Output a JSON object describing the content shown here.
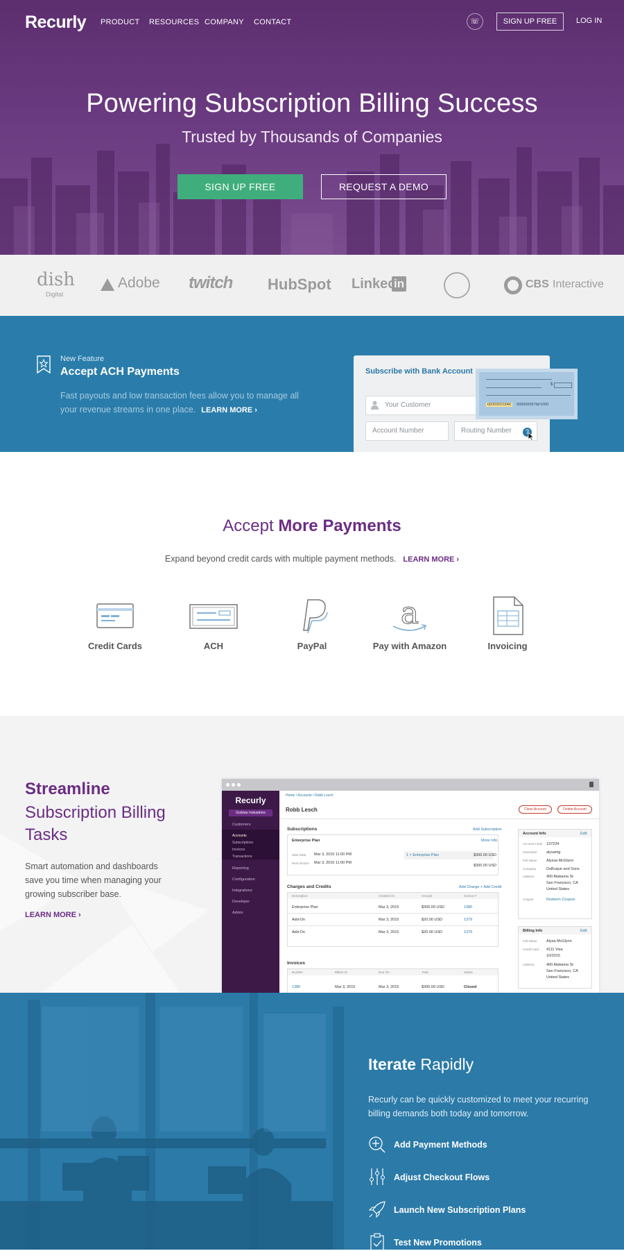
{
  "nav": {
    "logo": "Recurly",
    "product": "PRODUCT",
    "resources": "RESOURCES",
    "company": "COMPANY",
    "contact": "CONTACT",
    "signup": "SIGN UP FREE",
    "login": "LOG IN"
  },
  "hero": {
    "title": "Powering Subscription Billing Success",
    "subtitle": "Trusted by Thousands of Companies",
    "signup": "SIGN UP FREE",
    "demo": "REQUEST A DEMO"
  },
  "logos": [
    "dish",
    "Digital",
    "Adobe",
    "twitch",
    "HubSpot",
    "Linked",
    "in",
    "CBS",
    "Interactive"
  ],
  "ach": {
    "tag": "New Feature",
    "title": "Accept ACH Payments",
    "desc": "Fast payouts and low transaction fees allow you to manage all your revenue streams in one place.",
    "learn": "LEARN MORE ›",
    "form_title": "Subscribe with Bank Account",
    "customer": "Your Customer",
    "account": "Account Number",
    "routing": "Routing Number",
    "q": "?",
    "check_routing": "⑆000000184⑆",
    "check_account": "0000000579⑈",
    "check_no": "1000",
    "check_dollar": "$"
  },
  "payments": {
    "title_a": "Accept ",
    "title_b": "More Payments",
    "sub": "Expand beyond credit cards with multiple payment methods.",
    "learn": "LEARN MORE ›",
    "methods": [
      "Credit Cards",
      "ACH",
      "PayPal",
      "Pay with Amazon",
      "Invoicing"
    ]
  },
  "stream": {
    "title1": "Streamline",
    "title2": "Subscription Billing Tasks",
    "desc": "Smart automation and dashboards save you time when managing your growing subscriber base.",
    "learn": "LEARN MORE ›"
  },
  "app": {
    "logo": "Recurly",
    "company": "Goblas Industries",
    "nav": [
      "Customers",
      "Reporting",
      "Configuration",
      "Integrations",
      "Developer",
      "Admin"
    ],
    "subnav": [
      "Accounts",
      "Subscriptions",
      "Invoices",
      "Transactions"
    ],
    "crumbs": "Home  /  Accounts  /  Robb Lesch",
    "name": "Robb Lesch",
    "close": "Close Account",
    "delete": "Delete Account",
    "subs_title": "Subscriptions",
    "add_sub": "Add Subscription",
    "plan": "Enterprise Plan",
    "more": "More Info",
    "start_lbl": "Start Date",
    "start": "Mar 3, 2015 11:00 PM",
    "next_lbl": "Next Invoice",
    "next": "Mar 3, 2016 11:00 PM",
    "plan_line": "1 × Enterprise Plan",
    "plan_amt": "$300.00 USD",
    "plan_total": "$300.00 USD",
    "charges_title": "Charges and Credits",
    "add_charge": "Add Charge  +  Add Credit",
    "charges_head": [
      "Description",
      "Created On",
      "Amount",
      "Invoice #"
    ],
    "charges": [
      [
        "Enterprise Plan",
        "Mar 3, 2015",
        "$300.00 USD",
        "1380"
      ],
      [
        "Add-On",
        "Mar 3, 2015",
        "$20.00 USD",
        "1379"
      ],
      [
        "Add-On",
        "Mar 3, 2015",
        "$20.00 USD",
        "1379"
      ]
    ],
    "inv_title": "Invoices",
    "inv_head": [
      "Number",
      "Billed On",
      "Due On",
      "Total",
      "Status"
    ],
    "inv_row": [
      "1380",
      "Mar 3, 2015",
      "Mar 3, 2015",
      "$300.00 USD",
      "Closed"
    ],
    "acct_title": "Account Info",
    "edit": "Edit",
    "acct": [
      [
        "Account Code",
        "137234"
      ],
      [
        "Username",
        "alysamg"
      ],
      [
        "Full Name",
        "Alyssa McGlynn"
      ],
      [
        "Company",
        "DuBuque and Sons"
      ],
      [
        "Address",
        "400 Alabama St"
      ],
      [
        "",
        "San Francisco, CA"
      ],
      [
        "",
        "United States"
      ],
      [
        "Coupon",
        "Redeem Coupon"
      ]
    ],
    "bill_title": "Billing Info",
    "bill": [
      [
        "Full Name",
        "Alysa McGlynn"
      ],
      [
        "Credit Card",
        "4111 Visa"
      ],
      [
        "",
        "10/2015"
      ],
      [
        "Address",
        "400 Alabama St"
      ],
      [
        "",
        "San Francisco, CA"
      ],
      [
        "",
        "United States"
      ]
    ]
  },
  "iterate": {
    "title_a": "Iterate",
    "title_b": " Rapidly",
    "desc": "Recurly can be quickly customized to meet your recurring billing demands both today and tomorrow.",
    "items": [
      "Add Payment Methods",
      "Adjust Checkout Flows",
      "Launch New Subscription Plans",
      "Test New Promotions"
    ]
  },
  "colors": {
    "purple": "#6b2d83",
    "green": "#3fae7c",
    "blue": "#2a7dab"
  }
}
